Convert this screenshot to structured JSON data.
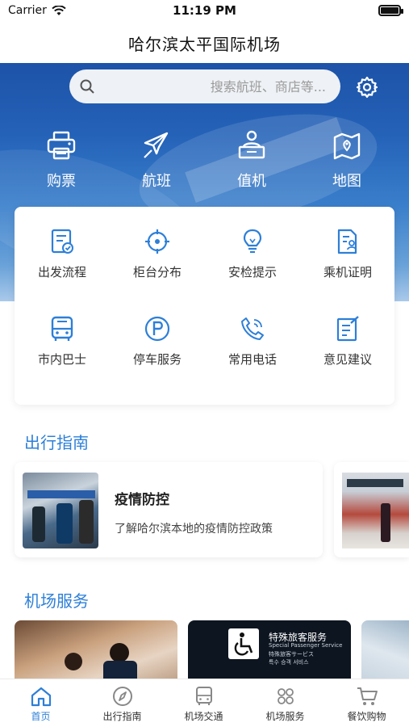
{
  "status_bar": {
    "carrier": "Carrier",
    "time": "11:19 PM",
    "battery_level": 1.0
  },
  "nav": {
    "title": "哈尔滨太平国际机场"
  },
  "search": {
    "placeholder": "搜索航班、商店等..."
  },
  "quick_actions": [
    {
      "label": "购票",
      "icon": "printer-icon"
    },
    {
      "label": "航班",
      "icon": "airplane-icon"
    },
    {
      "label": "值机",
      "icon": "checkin-person-icon"
    },
    {
      "label": "地图",
      "icon": "map-icon"
    }
  ],
  "services_grid": [
    {
      "label": "出发流程",
      "icon": "departure-form-icon"
    },
    {
      "label": "柜台分布",
      "icon": "target-icon"
    },
    {
      "label": "安检提示",
      "icon": "lightbulb-icon"
    },
    {
      "label": "乘机证明",
      "icon": "document-person-icon"
    },
    {
      "label": "市内巴士",
      "icon": "bus-icon"
    },
    {
      "label": "停车服务",
      "icon": "parking-icon"
    },
    {
      "label": "常用电话",
      "icon": "phone-icon"
    },
    {
      "label": "意见建议",
      "icon": "feedback-icon"
    }
  ],
  "travel_guide": {
    "section_title": "出行指南",
    "cards": [
      {
        "title": "疫情防控",
        "description": "了解哈尔滨本地的疫情防控政策"
      }
    ]
  },
  "airport_services": {
    "section_title": "机场服务",
    "special_passenger": {
      "title": "特殊旅客服务",
      "subtitle": "Special Passenger Service",
      "line1": "特殊旅客サービス",
      "line2": "특수 승객 서비스"
    }
  },
  "tabs": [
    {
      "label": "首页",
      "icon": "home-icon",
      "active": true
    },
    {
      "label": "出行指南",
      "icon": "compass-icon",
      "active": false
    },
    {
      "label": "机场交通",
      "icon": "bus-front-icon",
      "active": false
    },
    {
      "label": "机场服务",
      "icon": "services-grid-icon",
      "active": false
    },
    {
      "label": "餐饮购物",
      "icon": "cart-icon",
      "active": false
    }
  ],
  "colors": {
    "accent": "#2d7fd8",
    "hero_top": "#1d53a8",
    "text": "#222222"
  }
}
